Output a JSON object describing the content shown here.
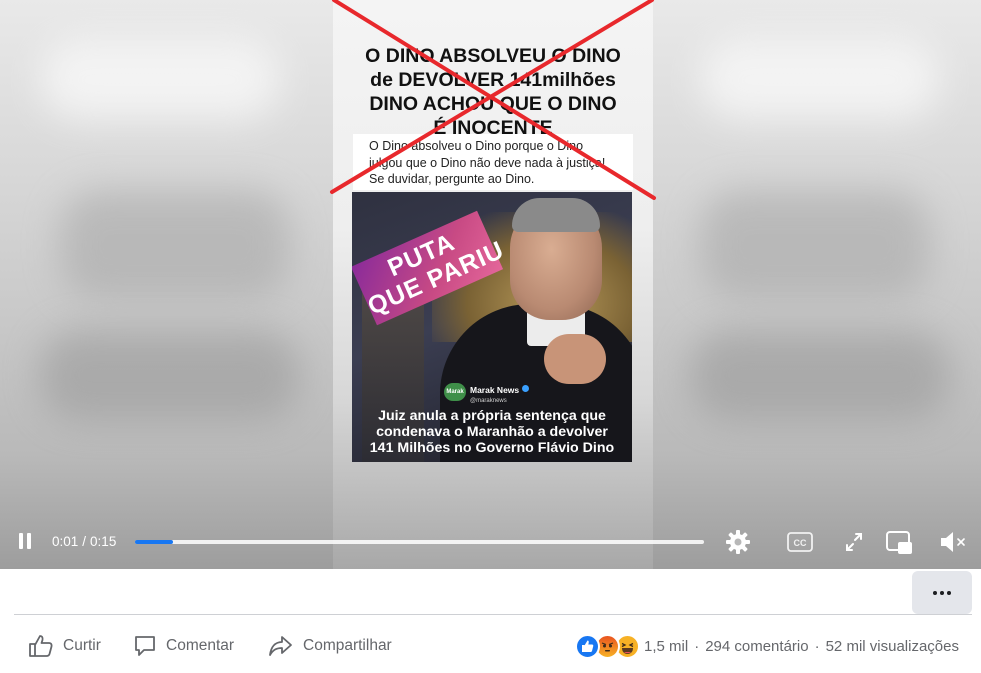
{
  "video": {
    "headline_lines": [
      "O DINO ABSOLVEU O DINO",
      "de DEVOLVER 141milhões",
      "DINO ACHOU QUE O DINO",
      "É INOCENTE"
    ],
    "caption_lines": [
      "O Dino absolveu o Dino porque o Dino",
      "julgou que o Dino não deve nada à justiça!",
      "Se duvidar, pergunte ao Dino."
    ],
    "sticker_lines": [
      "PUTA",
      "QUE PARIU"
    ],
    "brand": {
      "logo_text": "Marak",
      "name": "Marak News",
      "handle": "@maraknews"
    },
    "photo_caption_lines": [
      "Juiz anula a própria sentença que",
      "condenava o Maranhão a devolver",
      "141 Milhões no Governo Flávio Dino"
    ],
    "cross_color": "#e8282c"
  },
  "player": {
    "current_time": "0:01",
    "duration": "0:15",
    "progress_fraction": 0.067,
    "accent": "#1877f2",
    "icons": [
      "pause-icon",
      "settings-icon",
      "closed-captions-icon",
      "fullscreen-icon",
      "miniplayer-icon",
      "volume-muted-icon"
    ],
    "cc_label": "CC"
  },
  "more_menu": {
    "icon": "more-horizontal-icon"
  },
  "actions": {
    "like_label": "Curtir",
    "comment_label": "Comentar",
    "share_label": "Compartilhar"
  },
  "stats": {
    "reactions_count": "1,5 mil",
    "comments": "294 comentário",
    "views": "52 mil visualizações",
    "separator": "·",
    "reaction_icons": [
      "like-reaction-icon",
      "angry-reaction-icon",
      "haha-reaction-icon"
    ]
  }
}
